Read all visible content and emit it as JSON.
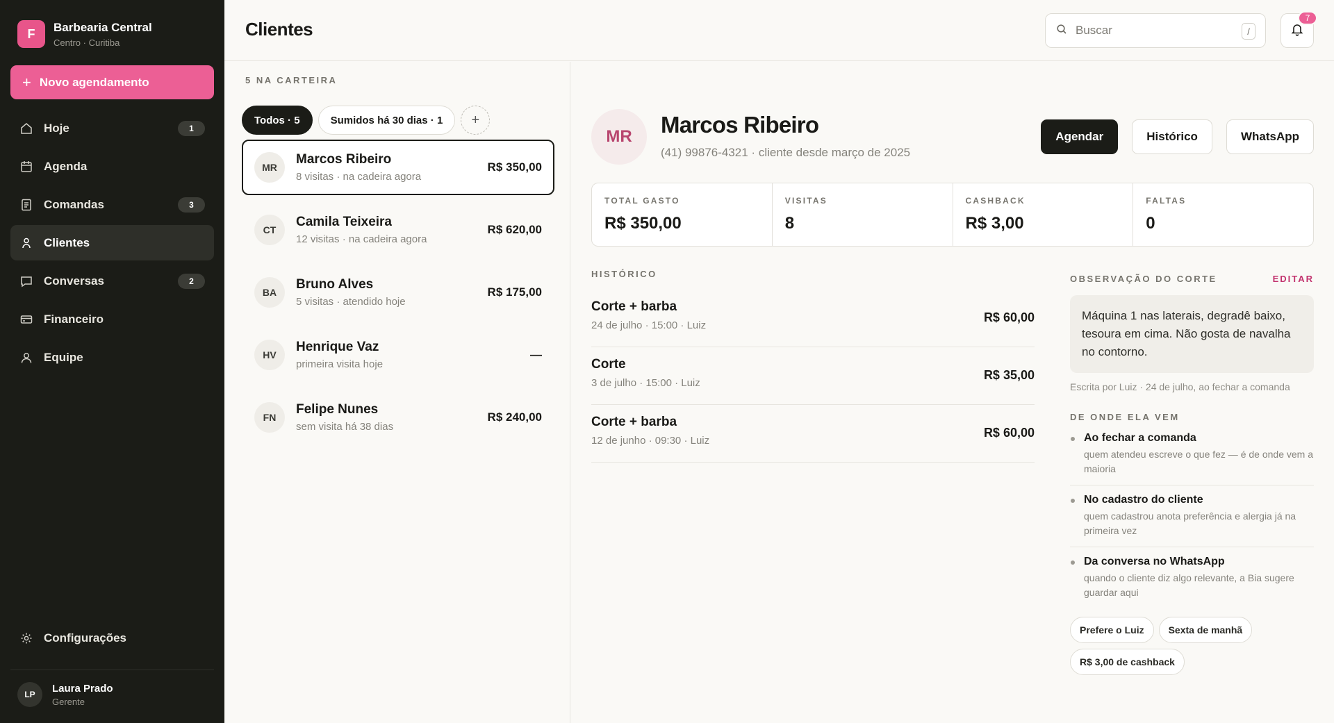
{
  "brand": {
    "initial": "F",
    "name": "Barbearia Central",
    "location": "Centro · Curitiba"
  },
  "sidebar": {
    "new_button": "Novo agendamento",
    "items": [
      {
        "label": "Hoje",
        "icon": "home-icon",
        "badge": "1"
      },
      {
        "label": "Agenda",
        "icon": "calendar-icon",
        "badge": ""
      },
      {
        "label": "Comandas",
        "icon": "receipt-icon",
        "badge": "3"
      },
      {
        "label": "Clientes",
        "icon": "clients-icon",
        "badge": "",
        "active": true
      },
      {
        "label": "Conversas",
        "icon": "chat-icon",
        "badge": "2"
      },
      {
        "label": "Financeiro",
        "icon": "card-icon",
        "badge": ""
      },
      {
        "label": "Equipe",
        "icon": "team-icon",
        "badge": ""
      }
    ],
    "settings": "Configurações",
    "user": {
      "initials": "LP",
      "name": "Laura Prado",
      "role": "Gerente"
    }
  },
  "header": {
    "title": "Clientes",
    "search_placeholder": "Buscar",
    "search_shortcut": "/",
    "notifications": "7"
  },
  "list": {
    "count_label": "5 NA CARTEIRA",
    "filters": [
      {
        "label": "Todos · 5",
        "active": true
      },
      {
        "label": "Sumidos há 30 dias · 1",
        "active": false
      }
    ],
    "add_filter": "+",
    "clients": [
      {
        "initials": "MR",
        "name": "Marcos Ribeiro",
        "sub": "8 visitas · na cadeira agora",
        "amount": "R$ 350,00",
        "selected": true
      },
      {
        "initials": "CT",
        "name": "Camila Teixeira",
        "sub": "12 visitas · na cadeira agora",
        "amount": "R$ 620,00"
      },
      {
        "initials": "BA",
        "name": "Bruno Alves",
        "sub": "5 visitas · atendido hoje",
        "amount": "R$ 175,00"
      },
      {
        "initials": "HV",
        "name": "Henrique Vaz",
        "sub": "primeira visita hoje",
        "amount": "—"
      },
      {
        "initials": "FN",
        "name": "Felipe Nunes",
        "sub": "sem visita há 38 dias",
        "amount": "R$ 240,00"
      }
    ]
  },
  "detail": {
    "initials": "MR",
    "name": "Marcos Ribeiro",
    "sub": "(41) 99876-4321 · cliente desde março de 2025",
    "actions": {
      "schedule": "Agendar",
      "history": "Histórico",
      "whatsapp": "WhatsApp"
    },
    "stats": [
      {
        "label": "TOTAL GASTO",
        "value": "R$ 350,00"
      },
      {
        "label": "VISITAS",
        "value": "8"
      },
      {
        "label": "CASHBACK",
        "value": "R$ 3,00"
      },
      {
        "label": "FALTAS",
        "value": "0"
      }
    ],
    "history_label": "HISTÓRICO",
    "history": [
      {
        "service": "Corte + barba",
        "meta": "24 de julho · 15:00 · Luiz",
        "amount": "R$ 60,00"
      },
      {
        "service": "Corte",
        "meta": "3 de julho · 15:00 · Luiz",
        "amount": "R$ 35,00"
      },
      {
        "service": "Corte + barba",
        "meta": "12 de junho · 09:30 · Luiz",
        "amount": "R$ 60,00"
      }
    ],
    "notes": {
      "label": "OBSERVAÇÃO DO CORTE",
      "edit": "EDITAR",
      "text": "Máquina 1 nas laterais, degradê baixo, tesoura em cima. Não gosta de navalha no contorno.",
      "meta": "Escrita por Luiz · 24 de julho, ao fechar a comanda"
    },
    "origin_label": "DE ONDE ELA VEM",
    "origins": [
      {
        "title": "Ao fechar a comanda",
        "desc": "quem atendeu escreve o que fez — é de onde vem a maioria"
      },
      {
        "title": "No cadastro do cliente",
        "desc": "quem cadastrou anota preferência e alergia já na primeira vez"
      },
      {
        "title": "Da conversa no WhatsApp",
        "desc": "quando o cliente diz algo relevante, a Bia sugere guardar aqui"
      }
    ],
    "tags": [
      "Prefere o Luiz",
      "Sexta de manhã",
      "R$ 3,00 de cashback"
    ]
  }
}
